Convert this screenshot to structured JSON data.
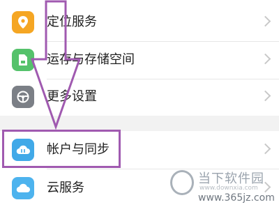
{
  "settings": {
    "items": [
      {
        "label": "定位服务",
        "icon": "location-pin-icon",
        "color": "#f5a623"
      },
      {
        "label": "运存与存储空间",
        "icon": "storage-card-icon",
        "color": "#55c26b"
      },
      {
        "label": "更多设置",
        "icon": "steering-wheel-icon",
        "color": "#7b7f86"
      },
      {
        "label": "帐户与同步",
        "icon": "cloud-sync-icon",
        "color": "#41a9e8"
      },
      {
        "label": "云服务",
        "icon": "cloud-icon",
        "color": "#4db3ee"
      }
    ]
  },
  "annotation": {
    "highlight_color": "#a05ab0",
    "target_item": "帐户与同步"
  },
  "watermark": {
    "name": "当下软件园",
    "url_small": "www.downxia.com",
    "url": "www.365jz.com"
  }
}
